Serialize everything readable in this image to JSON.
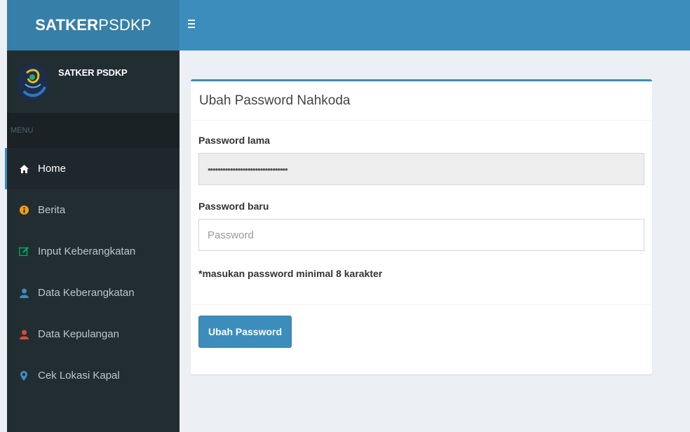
{
  "brand": {
    "bold": "SATKER",
    "light": "PSDKP"
  },
  "header": {
    "toggle_icon": "hamburger-icon"
  },
  "sidebar": {
    "user_name": "SATKER PSDKP",
    "menu_header": "MENU",
    "items": [
      {
        "label": "Home",
        "icon": "home-icon",
        "color": "#ffffff",
        "active": true
      },
      {
        "label": "Berita",
        "icon": "info-circle-icon",
        "color": "#f39c12"
      },
      {
        "label": "Input Keberangkatan",
        "icon": "edit-icon",
        "color": "#00a65a"
      },
      {
        "label": "Data Keberangkatan",
        "icon": "user-icon",
        "color": "#3c8dbc"
      },
      {
        "label": "Data Kepulangan",
        "icon": "user-icon",
        "color": "#dd4b39"
      },
      {
        "label": "Cek Lokasi Kapal",
        "icon": "map-marker-icon",
        "color": "#3c8dbc"
      }
    ]
  },
  "form": {
    "title": "Ubah Password Nahkoda",
    "old_password_label": "Password lama",
    "old_password_value": "••••••••••••••••••••••••••••••••",
    "new_password_label": "Password baru",
    "new_password_placeholder": "Password",
    "hint": "*masukan password minimal 8 karakter",
    "submit_label": "Ubah Password"
  },
  "colors": {
    "primary": "#3c8dbc",
    "primary_dark": "#367fa9",
    "sidebar_bg": "#222d32",
    "content_bg": "#ecf0f5"
  }
}
